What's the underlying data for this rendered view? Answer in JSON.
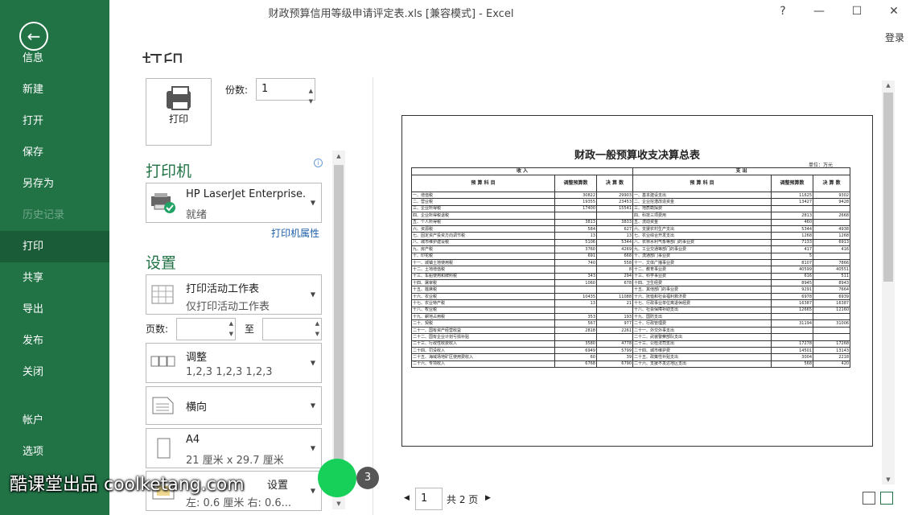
{
  "window": {
    "title": "财政预算信用等级申请评定表.xls  [兼容模式] - Excel",
    "help": "?",
    "minimize": "—",
    "restore": "☐",
    "close": "✕",
    "login": "登录"
  },
  "nav": {
    "back": "←",
    "items": [
      "信息",
      "新建",
      "打开",
      "保存",
      "另存为",
      "历史记录",
      "打印",
      "共享",
      "导出",
      "发布",
      "关闭",
      "帐户",
      "选项"
    ],
    "active": "打印"
  },
  "print": {
    "heading": "打印",
    "button": "打印",
    "copies_label": "份数:",
    "copies_value": "1",
    "printer_section": "打印机",
    "printer_name": "HP LaserJet Enterprise...",
    "printer_status": "就绪",
    "printer_props": "打印机属性",
    "settings_section": "设置",
    "scope_title": "打印活动工作表",
    "scope_sub": "仅打印活动工作表",
    "pages_label": "页数:",
    "to_label": "至",
    "collate_title": "调整",
    "collate_sub": "1,2,3    1,2,3    1,2,3",
    "orientation": "横向",
    "paper_title": "A4",
    "paper_sub": "21 厘米 x 29.7 厘米",
    "margins_title": "设置",
    "margins_sub": "左:  0.6 厘米    右:  0.6..."
  },
  "preview": {
    "sheet_title": "财政一般预算收支决算总表",
    "unit": "单位：万元",
    "header_income": "收                              入",
    "header_expense": "支                                出",
    "col_subject": "预          算          科          目",
    "col_budget": "调整预算数",
    "col_final": "决 算 数",
    "rows": [
      [
        "一、增值税",
        "30822",
        "29903",
        "一、基本建设支出",
        "11625",
        "9302"
      ],
      [
        "二、营业税",
        "19355",
        "23453",
        "二、企业挖潜改造资金",
        "13427",
        "9428"
      ],
      [
        "三、企业所得税",
        "17400",
        "15541",
        "三、地质勘探费",
        "",
        ""
      ],
      [
        "四、企业所得税退税",
        "",
        "",
        "四、科技三项费用",
        "2813",
        "2668"
      ],
      [
        "五、个人所得税",
        "3813",
        "3833",
        "五、流动资金",
        "460",
        ""
      ],
      [
        "六、资源税",
        "584",
        "627",
        "六、支援农村生产支出",
        "5344",
        "4938"
      ],
      [
        "七、固定资产投资方向调节税",
        "13",
        "13",
        "七、农业综合开发支出",
        "1268",
        "1268"
      ],
      [
        "八、城市维护建设税",
        "5106",
        "5344",
        "八、农林水利气象等部门的事业费",
        "7133",
        "6913"
      ],
      [
        "九、房产税",
        "3760",
        "4269",
        "九、工业交通等部门的事业费",
        "417",
        "416"
      ],
      [
        "十、印花税",
        "691",
        "668",
        "十、流通部门事业费",
        "5",
        ""
      ],
      [
        "十一、城镇土地使用税",
        "740",
        "558",
        "十一、文体广播事业费",
        "8107",
        "7866"
      ],
      [
        "十二、土地增值税",
        "",
        "8",
        "十二、教育事业费",
        "40599",
        "40551"
      ],
      [
        "十三、车船使用和牌照税",
        "343",
        "294",
        "十三、科学事业费",
        "616",
        "511"
      ],
      [
        "十四、屠宰税",
        "1060",
        "678",
        "十四、卫生经费",
        "8945",
        "8943"
      ],
      [
        "十五、筵席税",
        "",
        "",
        "十五、其他部门的事业费",
        "9291",
        "7664"
      ],
      [
        "十六、农业税",
        "10435",
        "11088",
        "十六、抚恤和社会福利救济费",
        "6978",
        "6939"
      ],
      [
        "十七、农业特产税",
        "13",
        "21",
        "十七、行政事业单位离退休经费",
        "16387",
        "16387"
      ],
      [
        "十八、牧业税",
        "",
        "",
        "十八、社会保障补助支出",
        "12665",
        "12160"
      ],
      [
        "十九、耕地占用税",
        "353",
        "193",
        "十九、国防支出",
        "",
        ""
      ],
      [
        "二十、契税",
        "567",
        "977",
        "二十、行政管理费",
        "31194",
        "31006"
      ],
      [
        "二十一、国有资产经营收益",
        "2818",
        "2261",
        "二十一、外交外事支出",
        "",
        ""
      ],
      [
        "二十二、国有企业计划亏损补贴",
        "",
        "",
        "二十二、武装警察部队支出",
        "",
        ""
      ],
      [
        "二十三、行政性收费收入",
        "3580",
        "4778",
        "二十三、公检法司支出",
        "17278",
        "17268"
      ],
      [
        "二十四、罚没收入",
        "6949",
        "5799",
        "二十四、城市维护费",
        "14501",
        "13143"
      ],
      [
        "二十五、海域场地矿区使用费收入",
        "60",
        "39",
        "二十五、政策性补贴支出",
        "3004",
        "2218"
      ],
      [
        "二十六、专项收入",
        "6768",
        "6790",
        "二十六、支援不发达地区支出",
        "568",
        "420"
      ]
    ],
    "page_value": "1",
    "page_total": "共 2 页",
    "prev": "◀",
    "next": "▶"
  },
  "overlay": {
    "watermark": "酷课堂出品 coolketang.com",
    "step": "3"
  }
}
